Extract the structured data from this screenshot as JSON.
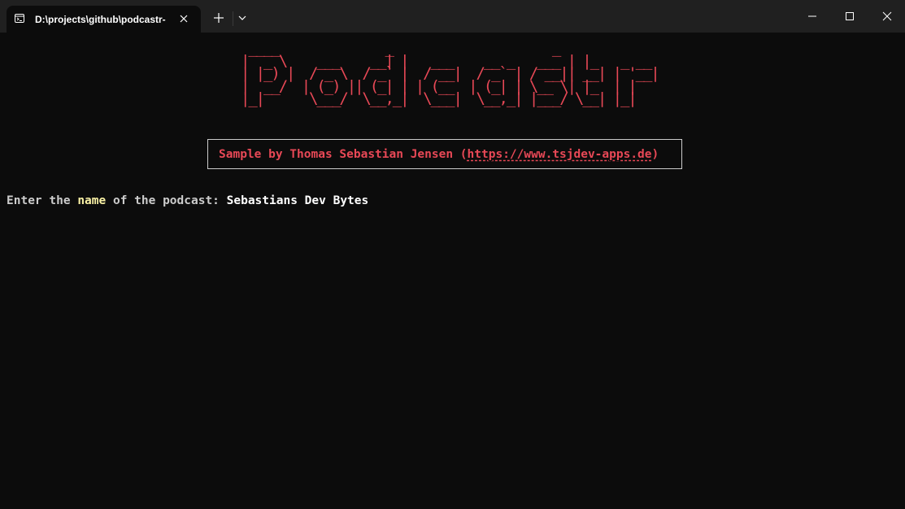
{
  "window": {
    "tab_title": "D:\\projects\\github\\podcastr-",
    "icons": {
      "tab": "terminal-icon",
      "close_tab": "close-icon",
      "new_tab": "plus-icon",
      "dropdown": "chevron-down-icon",
      "minimize": "minimize-icon",
      "maximize": "maximize-icon",
      "close_window": "close-icon"
    }
  },
  "terminal": {
    "ascii_banner_word": "Podcastr",
    "ascii_banner_lines": [
      " ____              _                     _          ",
      "|  _ \\    ___    __| |   ___    __ _   ___ | |_   _ __ ",
      "| |_) |  / _ \\  / _` |  / __|  / _` | / __|| __| | '__|",
      "|  __/  | (_) || (_| | | (__  | (_| | \\__ \\| |_  | |   ",
      "|_|      \\___/  \\__,_|  \\___|  \\__,_| |___/ \\__| |_|   "
    ],
    "sample_prefix": "Sample by Thomas Sebastian Jensen (",
    "sample_link": "https://www.tsjdev-apps.de",
    "sample_suffix": ")",
    "prompt_before": "Enter the ",
    "prompt_highlight": "name",
    "prompt_after": " of the podcast: ",
    "input_value": "Sebastians Dev Bytes"
  },
  "colors": {
    "background": "#0c0c0c",
    "titlebar": "#202020",
    "accent_red": "#e74856",
    "prompt_text": "#cccccc",
    "highlight": "#f9f1a5",
    "input_text": "#ffffff",
    "box_border": "#cccccc"
  }
}
